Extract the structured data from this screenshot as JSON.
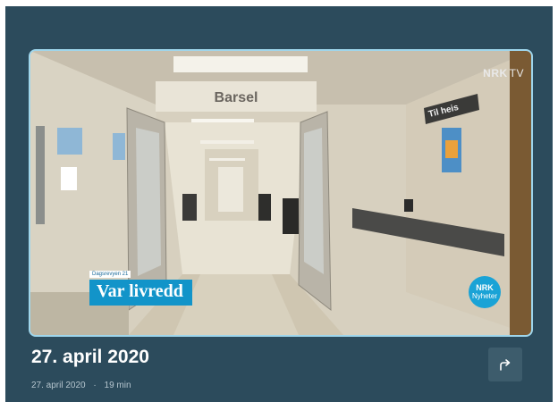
{
  "video": {
    "channel_logo": "NRK",
    "channel_suffix": "TV",
    "program_tag": "Dagsrevyen 21",
    "headline": "Var livredd",
    "scene_sign": "Barsel",
    "wall_sign": "Til heis",
    "badge_line1": "NRK",
    "badge_line2": "Nyheter"
  },
  "info": {
    "title": "27. april 2020",
    "date": "27. april 2020",
    "separator": "·",
    "duration": "19 min"
  },
  "share_icon": "share-arrow-icon"
}
